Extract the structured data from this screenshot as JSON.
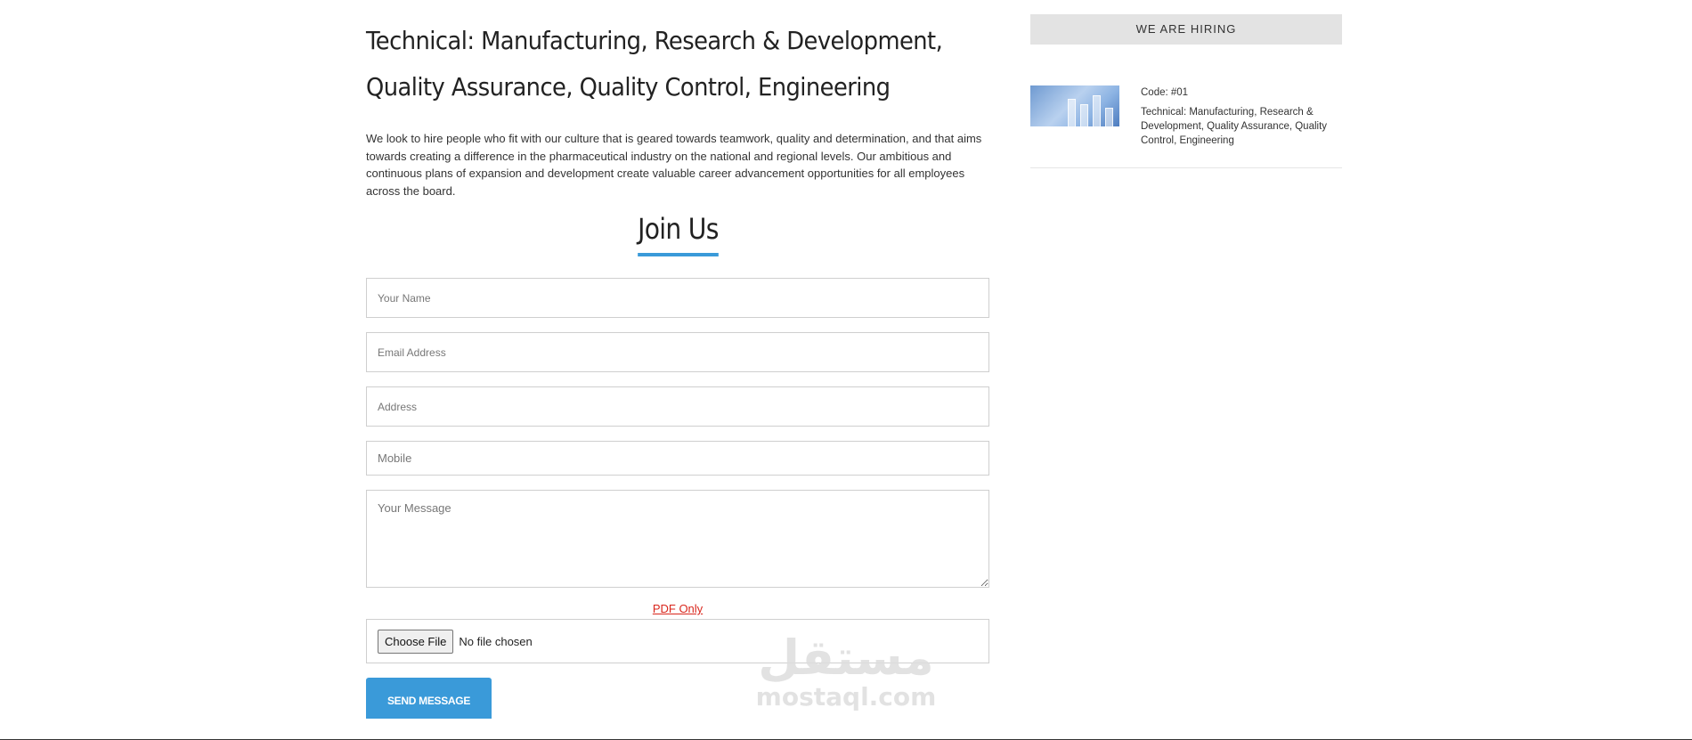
{
  "job": {
    "title": "Technical: Manufacturing, Research & Development, Quality Assurance, Quality Control, Engineering",
    "description": "We look to hire people who fit with our culture that is geared towards teamwork, quality and determination, and that aims towards creating a difference in the pharmaceutical industry on the national and regional levels. Our ambitious and continuous plans of expansion and development create valuable career advancement opportunities for all employees across the board."
  },
  "form": {
    "heading": "Join Us",
    "name_placeholder": "Your Name",
    "email_placeholder": "Email Address",
    "address_placeholder": "Address",
    "mobile_placeholder": "Mobile",
    "message_placeholder": "Your Message",
    "pdf_note": "PDF Only",
    "file_button_label": "Choose File",
    "file_status": "No file chosen",
    "submit_label": "SEND MESSAGE"
  },
  "sidebar": {
    "header": "WE ARE HIRING",
    "items": [
      {
        "code": "Code: #01",
        "title": "Technical: Manufacturing, Research & Development, Quality Assurance, Quality Control, Engineering",
        "thumbnail_icon": "lab-test-tubes-image"
      }
    ]
  },
  "watermark": {
    "arabic": "مستقل",
    "latin": "mostaql.com"
  },
  "colors": {
    "accent": "#3a9ad9",
    "pdf_note": "#d9261c",
    "sidebar_header_bg": "#e3e3e3"
  }
}
